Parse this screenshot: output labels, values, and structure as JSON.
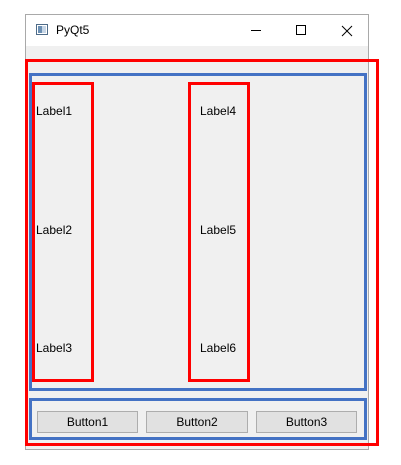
{
  "window": {
    "title": "PyQt5"
  },
  "titlebar_icons": {
    "app": "app-icon",
    "minimize": "minimize-icon",
    "maximize": "maximize-icon",
    "close": "close-icon"
  },
  "labels": {
    "column1": [
      "Label1",
      "Label2",
      "Label3"
    ],
    "column2": [
      "Label4",
      "Label5",
      "Label6"
    ]
  },
  "buttons": [
    "Button1",
    "Button2",
    "Button3"
  ],
  "colors": {
    "annotation_red": "#ff0000",
    "annotation_blue": "#4472c4",
    "window_bg": "#f0f0f0",
    "button_bg": "#e1e1e1"
  }
}
